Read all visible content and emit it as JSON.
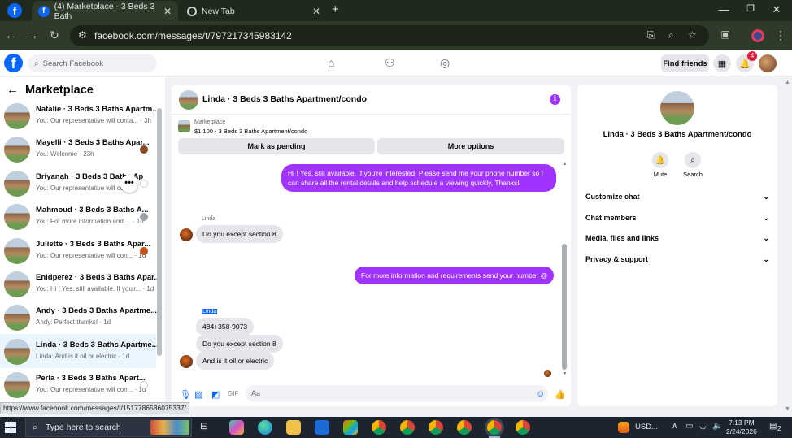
{
  "browser": {
    "tabs": [
      {
        "title": "(4) Marketplace - 3 Beds 3 Bath",
        "active": true
      },
      {
        "title": "New Tab",
        "active": false
      }
    ],
    "new_tab_symbol": "+",
    "url": "facebook.com/messages/t/797217345983142"
  },
  "fb_header": {
    "search_placeholder": "Search Facebook",
    "find_friends": "Find friends",
    "notification_count": "4"
  },
  "left_panel": {
    "title": "Marketplace",
    "conversations": [
      {
        "name": "Natalie · 3 Beds 3 Baths Apartm...",
        "snippet": "You: Our representative will conta... · 3h",
        "selected": false
      },
      {
        "name": "Mayelli · 3 Beds 3 Baths Apar...",
        "snippet": "You: Welcome · 23h",
        "selected": false
      },
      {
        "name": "Briyanah · 3 Beds 3 Baths Ap",
        "snippet": "You: Our representative will co...",
        "selected": false
      },
      {
        "name": "Mahmoud · 3 Beds 3 Baths A...",
        "snippet": "You: For more information and ... · 1d",
        "selected": false
      },
      {
        "name": "Juliette · 3 Beds 3 Baths Apar...",
        "snippet": "You: Our representative will con... · 1d",
        "selected": false
      },
      {
        "name": "Enidperez · 3 Beds 3 Baths Apar...",
        "snippet": "You: Hi ! Yes, still available. If you'r... · 1d",
        "selected": false
      },
      {
        "name": "Andy · 3 Beds 3 Baths Apartme...",
        "snippet": "Andy: Perfect thanks! · 1d",
        "selected": false
      },
      {
        "name": "Linda · 3 Beds 3 Baths Apartme...",
        "snippet": "Linda: And is it oil or electric · 1d",
        "selected": true
      },
      {
        "name": "Perla · 3 Beds 3 Baths Apart...",
        "snippet": "You: Our representative will con... · 1d",
        "selected": false
      }
    ],
    "more_symbol": "•••"
  },
  "chat": {
    "title": "Linda · 3 Beds 3 Baths Apartment/condo",
    "listing_label": "Marketplace",
    "listing_price": "$1,100 - 3 Beds 3 Baths Apartment/condo",
    "mark_pending": "Mark as pending",
    "more_options": "More options",
    "messages": {
      "out1": "Hi ! Yes, still available. If you're interested, Please send me your phone number so I can share all the rental details and help schedule a viewing quickly, Thanks!",
      "sender1": "Linda",
      "in1": "Do you except section 8",
      "out2": "For more information and requirements send your number @",
      "sender2": "Linda",
      "in2": "484+358-9073",
      "in3": "Do you except section 8",
      "in4": "And is it oil or electric"
    },
    "input_placeholder": "Aa"
  },
  "right_panel": {
    "name": "Linda · 3 Beds 3 Baths Apartment/condo",
    "mute": "Mute",
    "search": "Search",
    "sections": [
      "Customize chat",
      "Chat members",
      "Media, files and links",
      "Privacy & support"
    ]
  },
  "status_url": "https://www.facebook.com/messages/t/1517786586075337/",
  "taskbar": {
    "search_placeholder": "Type here to search",
    "currency": "USD...",
    "time": "7:13 PM",
    "date": "2/24/2026",
    "notification_badge": "2"
  },
  "colors": {
    "accent_purple": "#a033ff",
    "fb_blue": "#0866ff",
    "notif_red": "#e41e3f"
  }
}
